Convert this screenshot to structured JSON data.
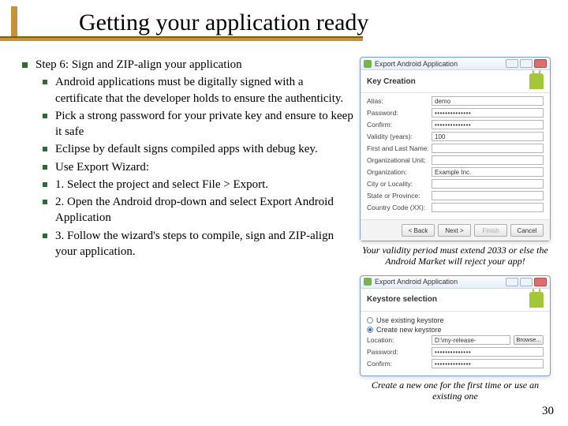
{
  "title": "Getting your application ready",
  "main_bullet": "Step 6: Sign and ZIP-align your application",
  "subs": [
    "Android applications must be digitally signed with a certificate that the developer holds   to ensure the authenticity.",
    "Pick a strong password for your private key and ensure to keep it safe",
    "Eclipse by default signs compiled apps with debug key.",
    "Use Export Wizard:",
    "1. Select the project and select File > Export.",
    "2. Open the Android drop-down and select Export Android Application",
    "3. Follow the wizard's steps to compile, sign and ZIP-align your application."
  ],
  "dialog1": {
    "window_title": "Export Android Application",
    "header": "Key Creation",
    "fields": {
      "alias_label": "Alias:",
      "alias_value": "demo",
      "password_label": "Password:",
      "confirm_label": "Confirm:",
      "validity_label": "Validity (years):",
      "validity_value": "100",
      "firstlast_label": "First and Last Name:",
      "orgunit_label": "Organizational Unit:",
      "org_label": "Organization:",
      "org_value": "Example Inc.",
      "city_label": "City or Locality:",
      "state_label": "State or Province:",
      "country_label": "Country Code (XX):"
    },
    "buttons": {
      "back": "< Back",
      "next": "Next >",
      "finish": "Finish",
      "cancel": "Cancel"
    }
  },
  "caption1": "Your validity period must extend 2033 or else the Android Market will reject your app!",
  "dialog2": {
    "window_title": "Export Android Application",
    "header": "Keystore selection",
    "radio_existing": "Use existing keystore",
    "radio_create": "Create new keystore",
    "location_label": "Location:",
    "location_value": "D:\\my-release-key.keystore",
    "password_label": "Password:",
    "confirm_label": "Confirm:",
    "browse": "Browse..."
  },
  "caption2": "Create a new one for the first time or use an existing one",
  "slide_number": "30",
  "dotmask": "••••••••••••••"
}
